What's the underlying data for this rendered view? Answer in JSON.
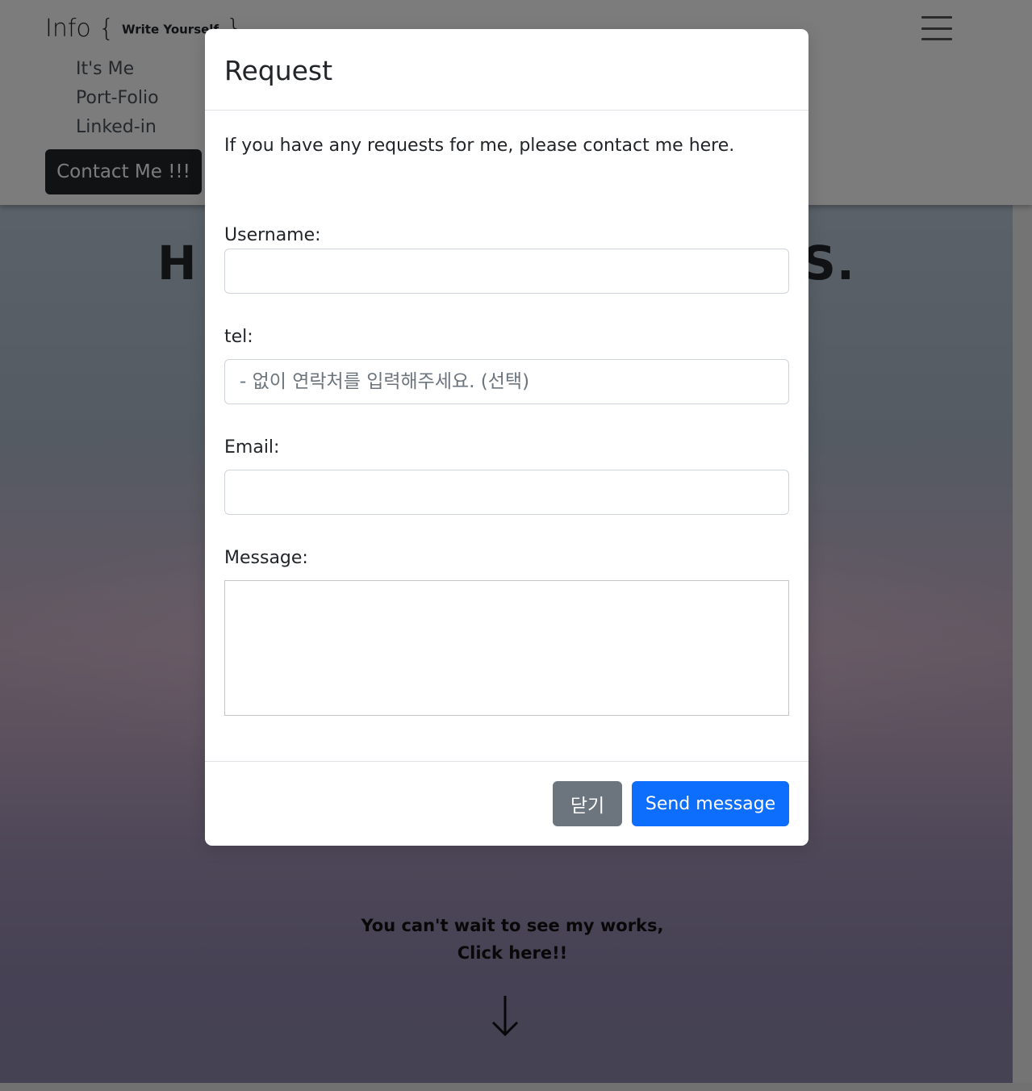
{
  "navbar": {
    "brand": "Info {",
    "brand_tag": "Write Yourself",
    "brand_close": "}",
    "links": [
      "It's Me",
      "Port-Folio",
      "Linked-in"
    ],
    "contact_button": "Contact Me !!!"
  },
  "hero": {
    "title_left": "H",
    "title_right": "HS.",
    "cta_line1": "You can't wait to see my works,",
    "cta_line2": "Click here!!"
  },
  "modal": {
    "title": "Request",
    "description": "If you have any requests for me, please contact me here.",
    "username_label": "Username:",
    "tel_label": "tel:",
    "tel_placeholder": "- 없이 연락처를 입력해주세요. (선택)",
    "email_label": "Email:",
    "message_label": "Message:",
    "close_button": "닫기",
    "send_button": "Send message"
  },
  "colors": {
    "primary": "#0d6efd",
    "secondary": "#6c757d",
    "dark": "#212529"
  }
}
